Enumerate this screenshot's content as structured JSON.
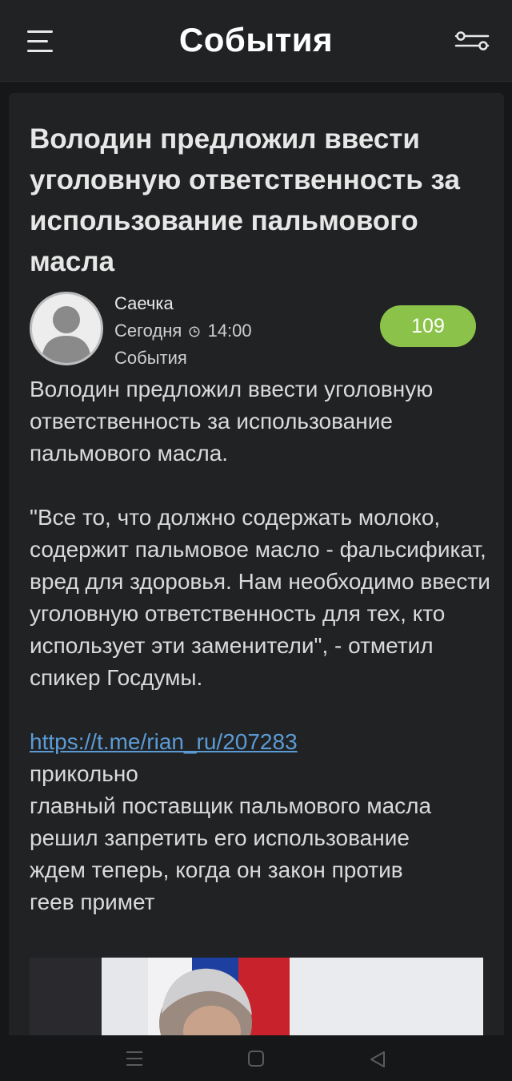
{
  "header": {
    "title": "События",
    "menu_icon": "hamburger-menu-icon",
    "filter_icon": "filter-sliders-icon"
  },
  "post": {
    "headline": "Володин предложил ввести уголовную ответственность за использование пальмового масла",
    "author": "Саечка",
    "date": "Сегодня",
    "time": "14:00",
    "category": "События",
    "comments_count": "109",
    "paragraph1": "Володин предложил ввести уголовную ответственность за использование пальмового масла.",
    "paragraph2": "\"Все то, что должно содержать молоко, содержит пальмовое масло - фальсификат, вред для здоровья. Нам необходимо ввести уголовную ответственность для тех, кто использует эти заменители\", - отметил спикер Госдумы.",
    "link": "https://t.me/rian_ru/207283",
    "comment_lines": [
      "прикольно",
      "главный поставщик пальмового масла",
      "решил запретить его использование",
      "ждем теперь, когда он закон против",
      "геев примет"
    ]
  },
  "colors": {
    "background": "#161719",
    "card": "#212224",
    "badge": "#8bc34a",
    "link": "#5b9bd5"
  },
  "system_nav": {
    "icons": [
      "recents-icon",
      "home-icon",
      "back-icon"
    ]
  }
}
